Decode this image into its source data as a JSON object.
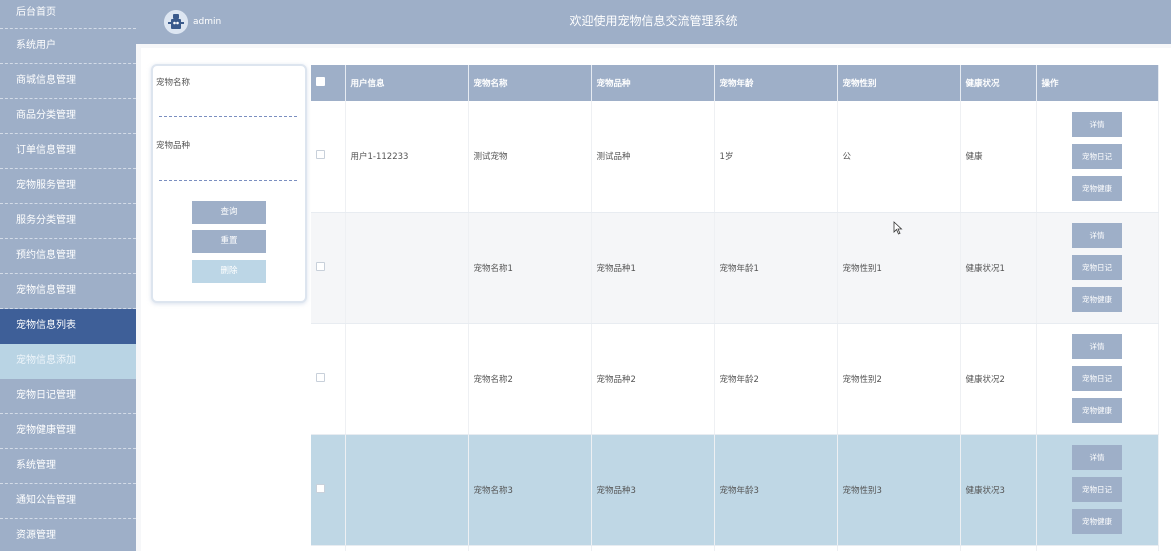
{
  "sidebar": {
    "items": [
      {
        "label": "后台首页"
      },
      {
        "label": "系统用户"
      },
      {
        "label": "商城信息管理"
      },
      {
        "label": "商品分类管理"
      },
      {
        "label": "订单信息管理"
      },
      {
        "label": "宠物服务管理"
      },
      {
        "label": "服务分类管理"
      },
      {
        "label": "预约信息管理"
      },
      {
        "label": "宠物信息管理"
      },
      {
        "label": "宠物信息列表"
      },
      {
        "label": "宠物信息添加"
      },
      {
        "label": "宠物日记管理"
      },
      {
        "label": "宠物健康管理"
      },
      {
        "label": "系统管理"
      },
      {
        "label": "通知公告管理"
      },
      {
        "label": "资源管理"
      }
    ]
  },
  "header": {
    "username": "admin",
    "title": "欢迎使用宠物信息交流管理系统",
    "avatar_icon": "robot-avatar-icon"
  },
  "search": {
    "name_label": "宠物名称",
    "name_value": "",
    "breed_label": "宠物品种",
    "breed_value": "",
    "query_label": "查询",
    "reset_label": "重置",
    "delete_label": "删除"
  },
  "table": {
    "headers": [
      "用户信息",
      "宠物名称",
      "宠物品种",
      "宠物年龄",
      "宠物性别",
      "健康状况",
      "操作"
    ],
    "rows": [
      {
        "user": "用户1-112233",
        "name": "测试宠物",
        "breed": "测试品种",
        "age": "1岁",
        "gender": "公",
        "health": "健康"
      },
      {
        "user": "",
        "name": "宠物名称1",
        "breed": "宠物品种1",
        "age": "宠物年龄1",
        "gender": "宠物性别1",
        "health": "健康状况1"
      },
      {
        "user": "",
        "name": "宠物名称2",
        "breed": "宠物品种2",
        "age": "宠物年龄2",
        "gender": "宠物性别2",
        "health": "健康状况2"
      },
      {
        "user": "",
        "name": "宠物名称3",
        "breed": "宠物品种3",
        "age": "宠物年龄3",
        "gender": "宠物性别3",
        "health": "健康状况3"
      }
    ],
    "actions": {
      "detail": "详情",
      "diary": "宠物日记",
      "health": "宠物健康"
    }
  },
  "colors": {
    "primary": "#9eafc8",
    "active": "#3e5f98",
    "sub_active": "#b9d4e4",
    "row_highlight": "#bfd7e5"
  }
}
